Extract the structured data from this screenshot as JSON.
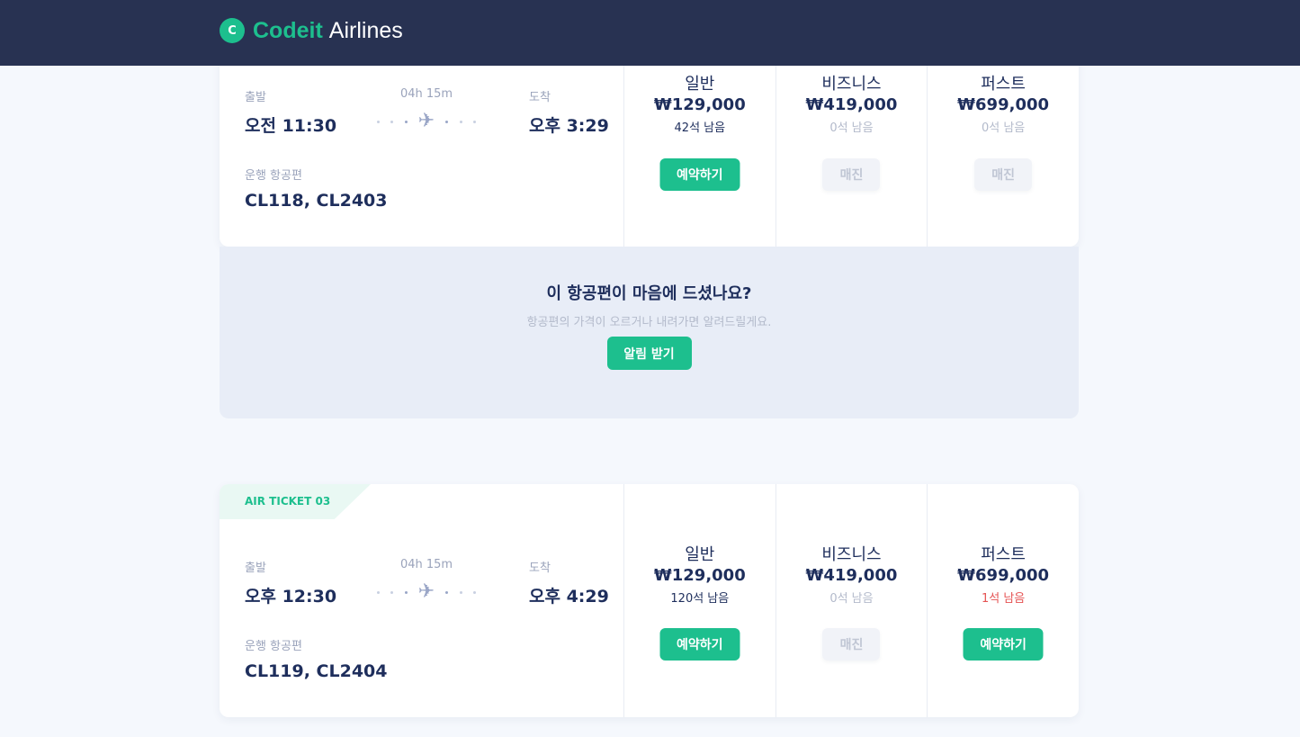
{
  "header": {
    "logo_icon": "c-arrow-icon",
    "logo_glyph": "C",
    "brand_primary": "Codeit",
    "brand_secondary": "Airlines"
  },
  "colors": {
    "accent": "#1dbf8e",
    "navbar": "#283252",
    "text_dark": "#1e2e5c",
    "text_muted": "#9aa3bb",
    "warning": "#e55353"
  },
  "tickets": [
    {
      "tag": "",
      "departure_label": "출발",
      "departure_time": "오전 11:30",
      "duration": "04h 15m",
      "arrival_label": "도착",
      "arrival_time": "오후 3:29",
      "flights_label": "운행 항공편",
      "flights": "CL118, CL2403",
      "classes": [
        {
          "name": "일반",
          "price": "₩129,000",
          "seats": "42석 남음",
          "button": "예약하기"
        },
        {
          "name": "비즈니스",
          "price": "₩419,000",
          "seats": "0석 남음",
          "button": "매진"
        },
        {
          "name": "퍼스트",
          "price": "₩699,000",
          "seats": "0석 남음",
          "button": "매진"
        }
      ]
    },
    {
      "tag": "AIR TICKET 03",
      "departure_label": "출발",
      "departure_time": "오후 12:30",
      "duration": "04h 15m",
      "arrival_label": "도착",
      "arrival_time": "오후 4:29",
      "flights_label": "운행 항공편",
      "flights": "CL119, CL2404",
      "classes": [
        {
          "name": "일반",
          "price": "₩129,000",
          "seats": "120석 남음",
          "button": "예약하기"
        },
        {
          "name": "비즈니스",
          "price": "₩419,000",
          "seats": "0석 남음",
          "button": "매진"
        },
        {
          "name": "퍼스트",
          "price": "₩699,000",
          "seats": "1석 남음",
          "button": "예약하기"
        }
      ]
    }
  ],
  "alert": {
    "title": "이 항공편이 마음에 드셨나요?",
    "subtitle": "항공편의 가격이 오르거나 내려가면 알려드릴게요.",
    "button": "알림 받기"
  },
  "icons": {
    "plane": "airplane-icon",
    "plane_glyph": "✈"
  }
}
